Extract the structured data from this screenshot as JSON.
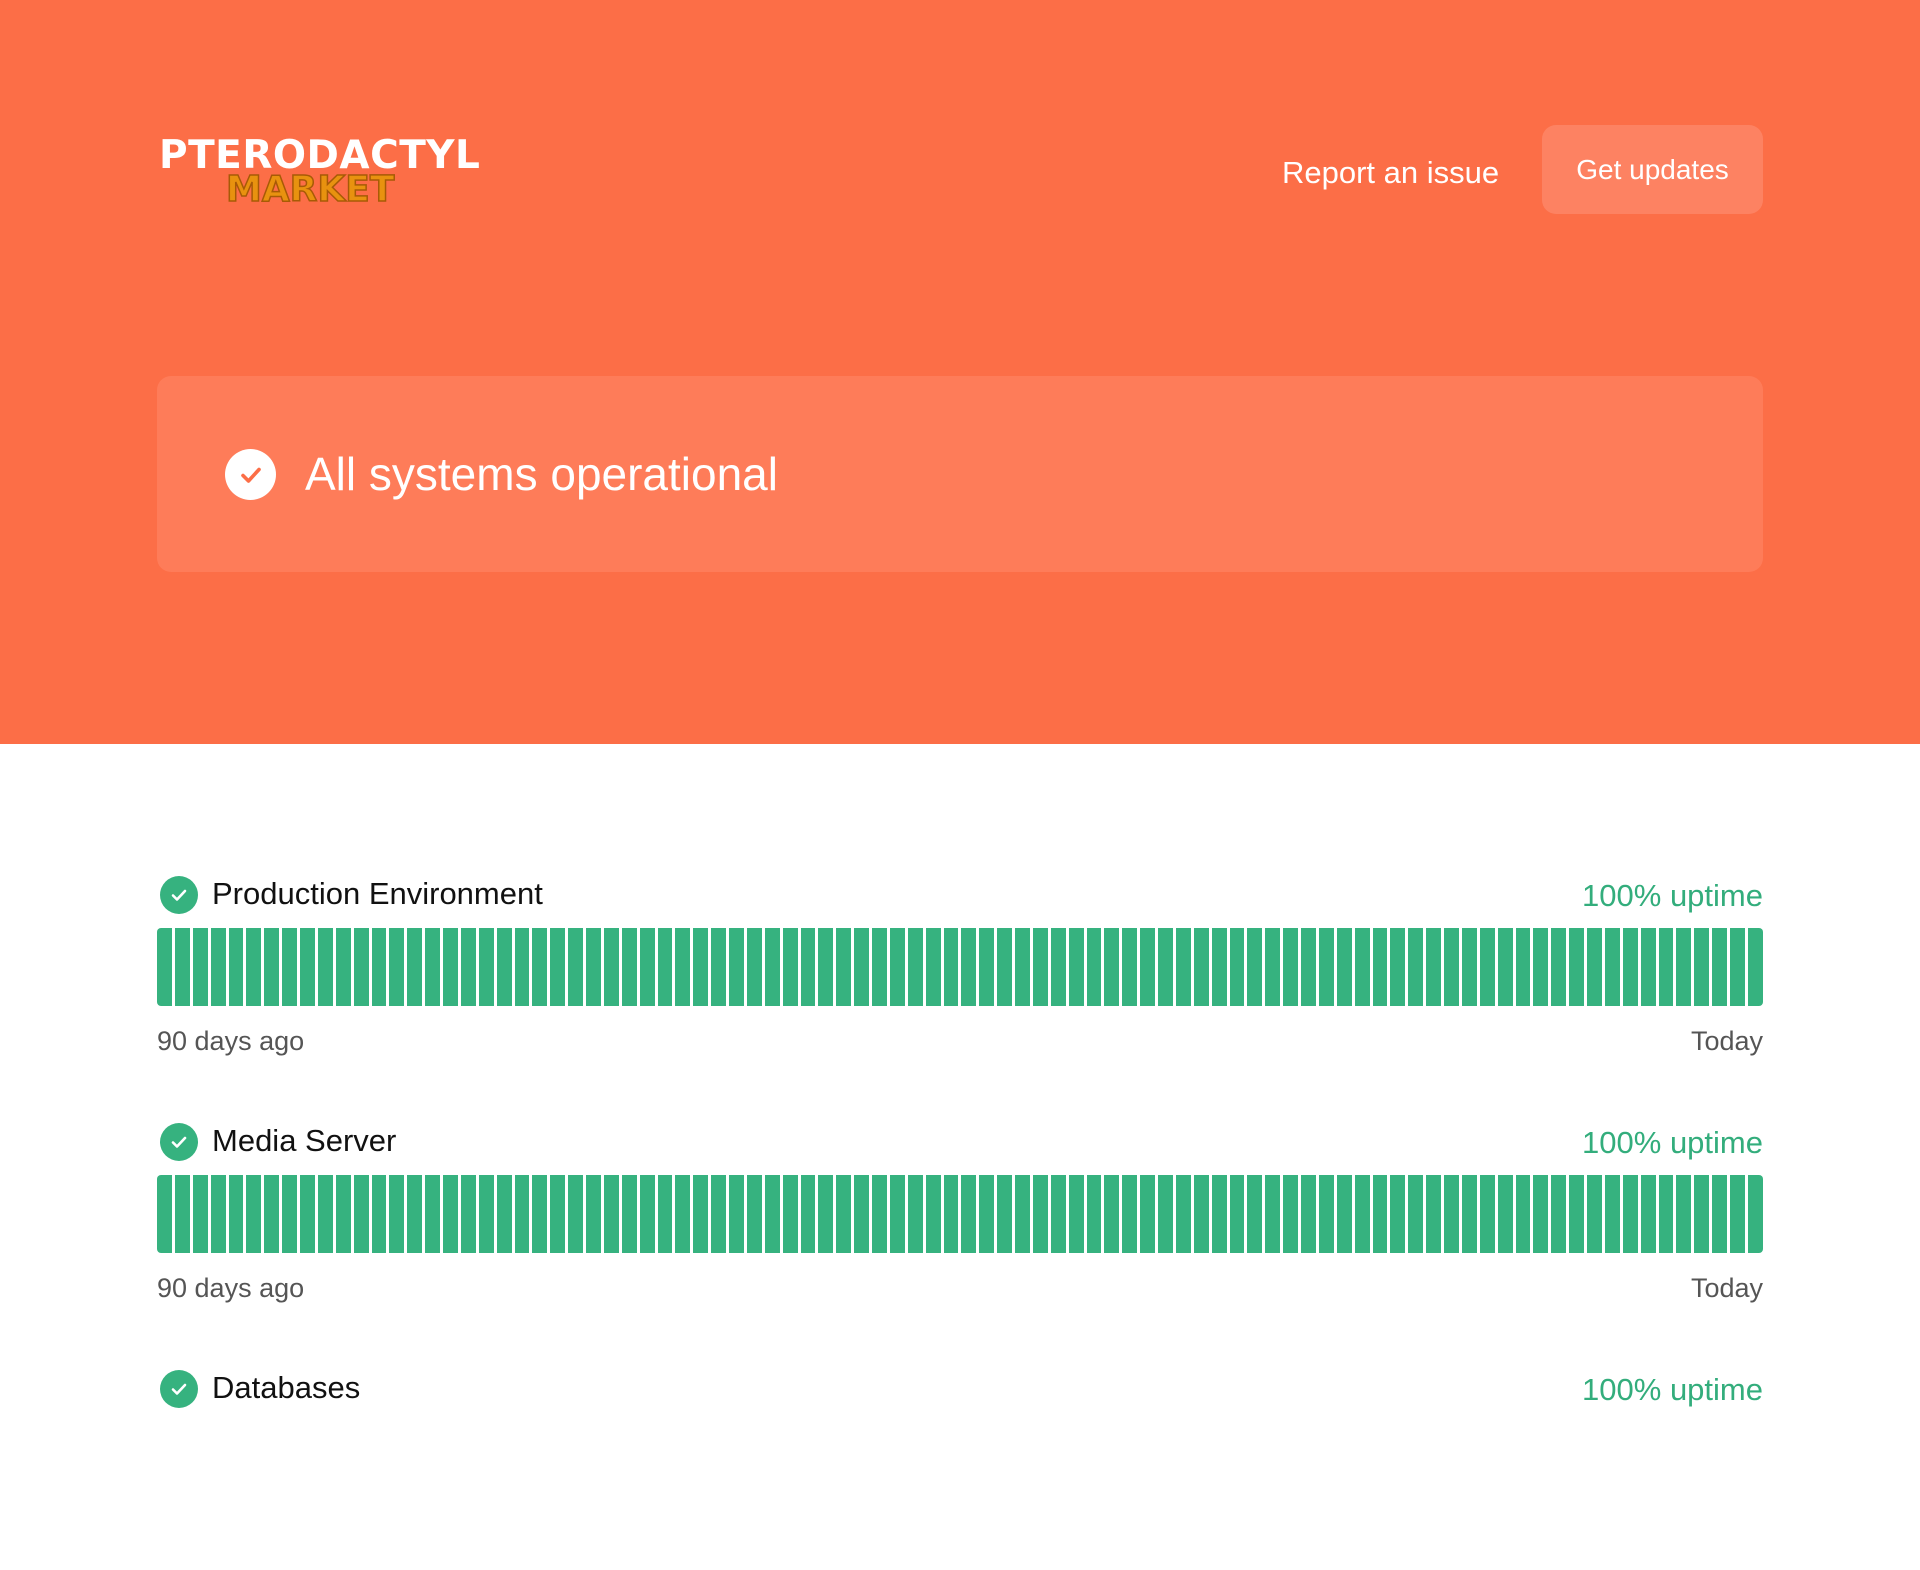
{
  "header": {
    "logo_line1": "PTERODACTYL",
    "logo_line2": "MARKET",
    "report_label": "Report an issue",
    "updates_label": "Get updates"
  },
  "status": {
    "icon": "check-circle-icon",
    "message": "All systems operational"
  },
  "components": [
    {
      "name": "Production Environment",
      "uptime": "100% uptime",
      "range_start": "90 days ago",
      "range_end": "Today",
      "day_count": 90,
      "day_status": "operational"
    },
    {
      "name": "Media Server",
      "uptime": "100% uptime",
      "range_start": "90 days ago",
      "range_end": "Today",
      "day_count": 90,
      "day_status": "operational"
    },
    {
      "name": "Databases",
      "uptime": "100% uptime"
    }
  ],
  "colors": {
    "brand": "#fc6e47",
    "operational": "#36b27f",
    "logo_accent": "#e8920f"
  }
}
